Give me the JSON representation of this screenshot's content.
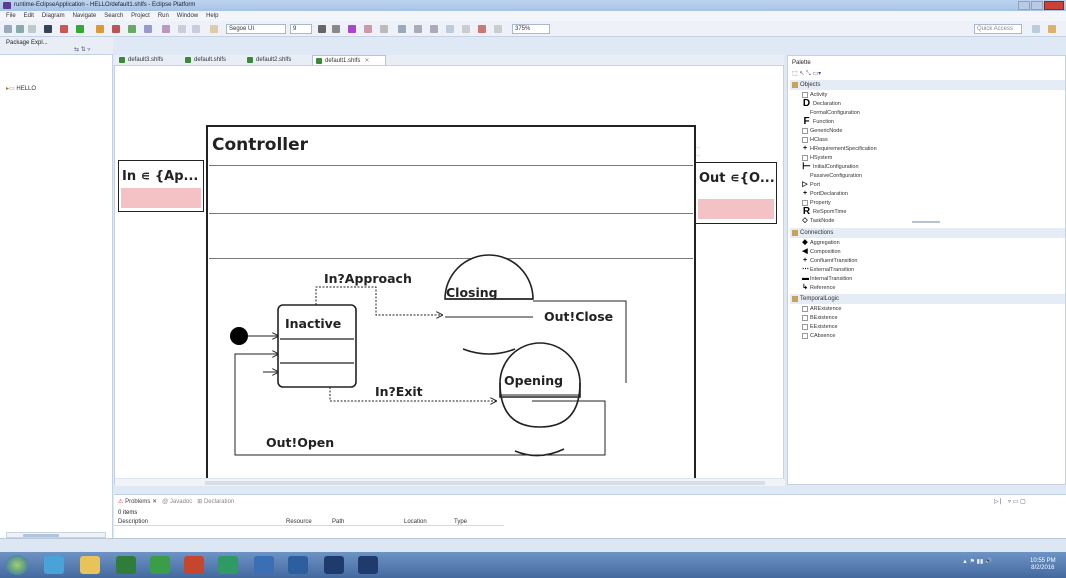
{
  "window": {
    "title": "runtime-EclipseApplication - HELLO/default1.shlfs - Eclipse Platform",
    "controls": [
      "–",
      "☐",
      "✕"
    ]
  },
  "menu": [
    "File",
    "Edit",
    "Diagram",
    "Navigate",
    "Search",
    "Project",
    "Run",
    "Window",
    "Help"
  ],
  "toolbar": {
    "font_combo": "Segoe UI",
    "size_combo": "9",
    "zoom_combo": "375%",
    "quick_access_placeholder": "Quick Access"
  },
  "explorer": {
    "title": "Package Expl...",
    "tree_item": "HELLO"
  },
  "editor_tabs": [
    "default3.shlfs",
    "default.shlfs",
    "default2.shlfs",
    "default1.shlfs"
  ],
  "diagram": {
    "input_port": "In ∊ {Ap...",
    "output_port": "Out ∊{O...",
    "controller": "Controller",
    "states": {
      "inactive": "Inactive",
      "closing": "Closing",
      "opening": "Opening"
    },
    "transitions": {
      "approach": "In?Approach",
      "close": "Out!Close",
      "exit": "In?Exit",
      "open": "Out!Open"
    }
  },
  "palette": {
    "title": "Palette",
    "sections": [
      {
        "name": "Objects",
        "items": [
          "Activity",
          "Declaration",
          "FormalConfiguration",
          "Function",
          "GenericNode",
          "HClass",
          "HRequirementSpecification",
          "HSystem",
          "InitialConfiguration",
          "PassiveConfiguration",
          "Port",
          "PortDeclaration",
          "Property",
          "ReSpomTime",
          "TaskNode"
        ]
      },
      {
        "name": "Connections",
        "items": [
          "Aggregation",
          "Composition",
          "ConfluentTransition",
          "ExternalTransition",
          "InternalTransition",
          "Reference"
        ]
      },
      {
        "name": "TemporalLogic",
        "items": [
          "ARExistence",
          "BExistence",
          "EExistence",
          "CAbsence"
        ]
      }
    ]
  },
  "problems": {
    "tabs": [
      "Problems",
      "Javadoc",
      "Declaration"
    ],
    "count": "0 items",
    "columns": [
      "Description",
      "Resource",
      "Path",
      "Location",
      "Type"
    ]
  },
  "taskbar": {
    "clock_time": "10:55 PM",
    "clock_date": "8/2/2016"
  },
  "colors": {
    "port_fill": "#f4c1c4",
    "taskbar": "#43699f"
  }
}
